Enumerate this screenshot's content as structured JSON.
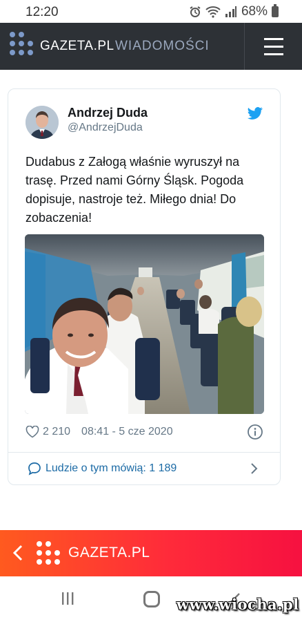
{
  "status_bar": {
    "time": "12:20",
    "battery": "68%"
  },
  "header": {
    "brand": "GAZETA.PL",
    "section": "WIADOMOŚCI"
  },
  "tweet": {
    "author_name": "Andrzej Duda",
    "author_handle": "@AndrzejDuda",
    "text": "Dudabus z Załogą właśnie wyruszył na trasę. Przed nami Górny Śląsk. Pogoda dopisuje, nastroje też. Miłego dnia! Do zobaczenia!",
    "likes": "2 210",
    "timestamp": "08:41 - 5 cze 2020",
    "conversation": "Ludzie o tym mówią: 1 189"
  },
  "bottom_bar": {
    "brand": "GAZETA.PL"
  },
  "watermark": "www.wiocha.pl",
  "colors": {
    "header_bg": "#2d3136",
    "twitter_blue": "#1da1f2",
    "link_blue": "#1b6aa5",
    "bar_red": "#ff2b3a",
    "bar_orange": "#ff5a1f"
  },
  "icons": [
    "wifi-icon",
    "signal-icon",
    "battery-icon",
    "hamburger-menu-icon",
    "twitter-bird-icon",
    "heart-icon",
    "info-icon",
    "chat-bubble-icon",
    "chevron-right-icon",
    "back-arrow-icon",
    "recent-apps-icon",
    "home-icon",
    "back-icon"
  ]
}
